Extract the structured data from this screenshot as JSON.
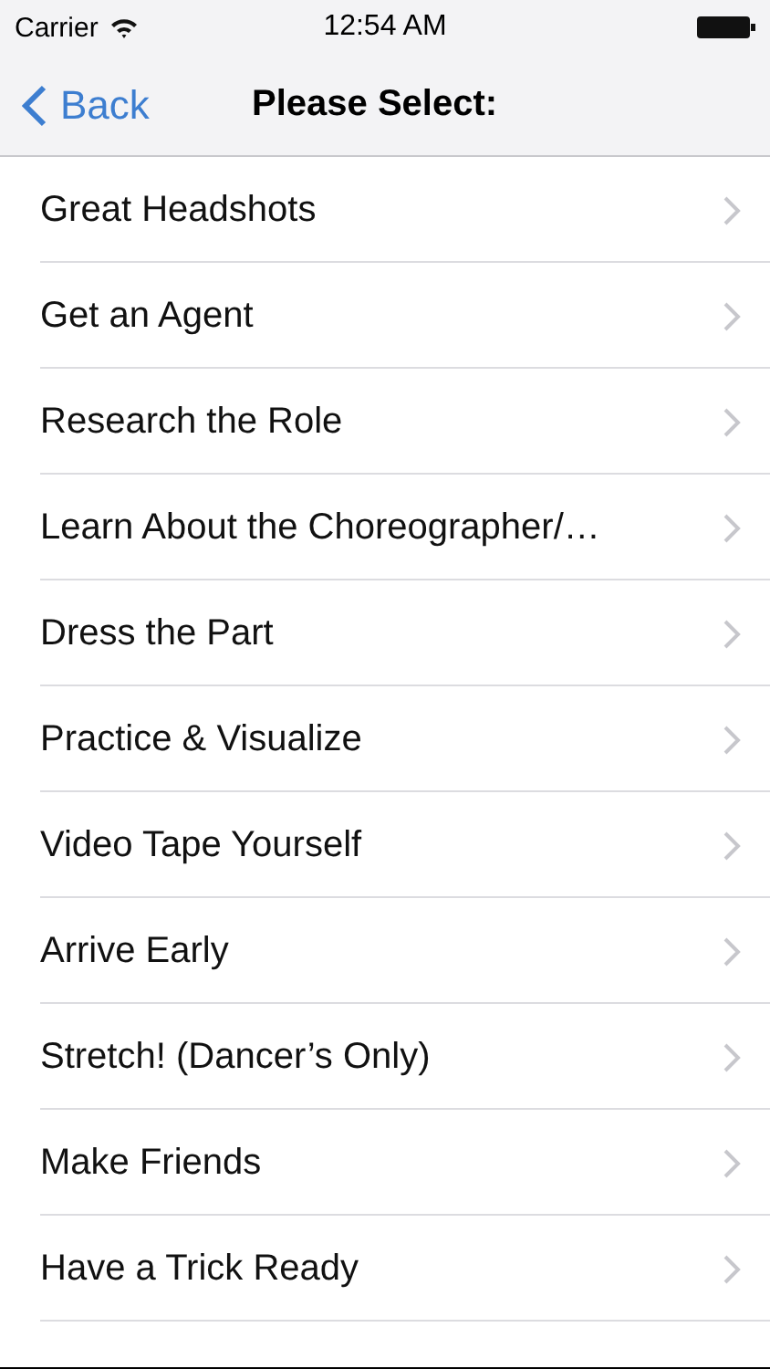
{
  "status_bar": {
    "carrier": "Carrier",
    "time": "12:54 AM"
  },
  "nav_bar": {
    "back": "Back",
    "title": "Please Select:"
  },
  "items": [
    {
      "label": "Great Headshots"
    },
    {
      "label": "Get an Agent"
    },
    {
      "label": "Research the Role"
    },
    {
      "label": "Learn About the Choreographer/…"
    },
    {
      "label": "Dress the Part"
    },
    {
      "label": "Practice & Visualize"
    },
    {
      "label": "Video Tape Yourself"
    },
    {
      "label": "Arrive Early"
    },
    {
      "label": "Stretch! (Dancer’s Only)"
    },
    {
      "label": "Make Friends"
    },
    {
      "label": "Have a Trick Ready"
    }
  ]
}
